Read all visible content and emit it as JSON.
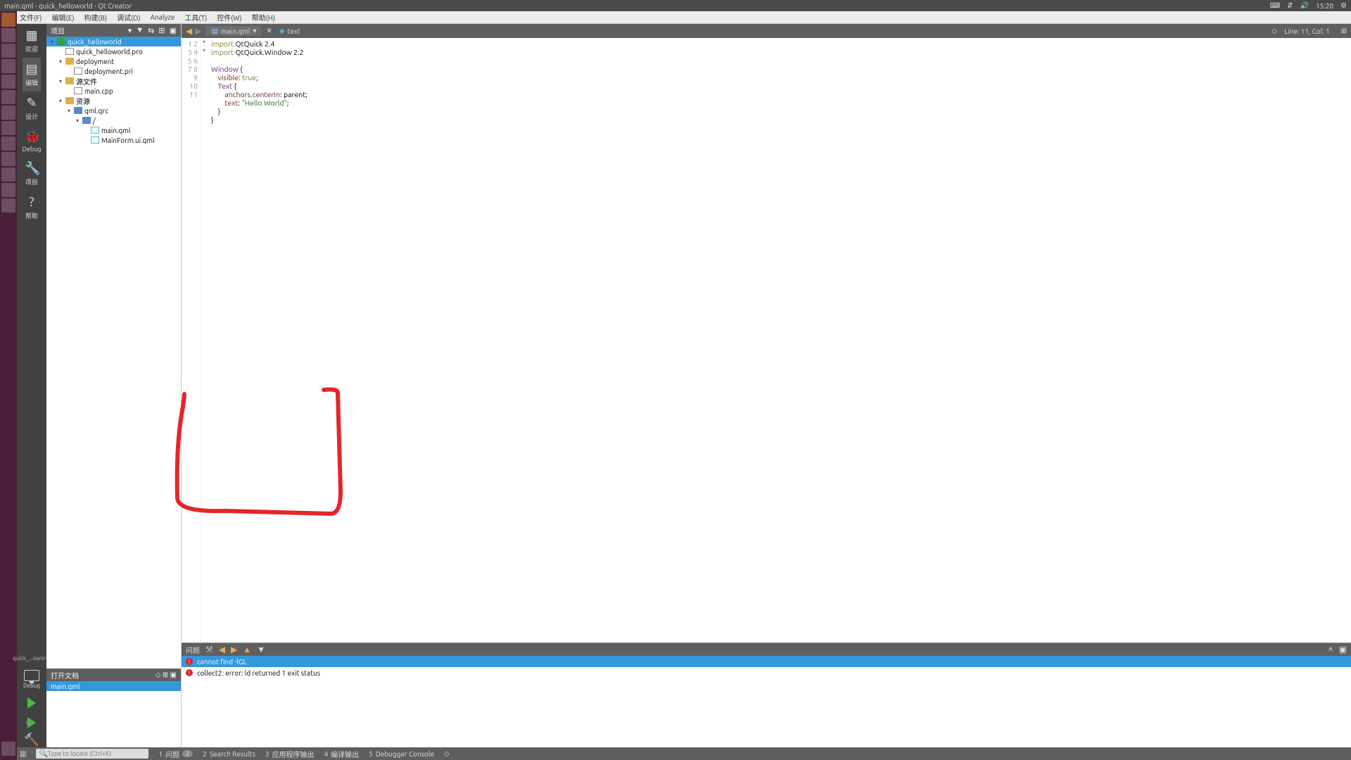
{
  "os": {
    "title": "main.qml - quick_helloworld - Qt Creator",
    "time": "15:20",
    "tray": [
      "keyboard-icon",
      "network-icon",
      "volume-icon",
      "settings-icon"
    ]
  },
  "menubar": [
    "文件(F)",
    "编辑(E)",
    "构建(B)",
    "调试(D)",
    "Analyze",
    "工具(T)",
    "控件(W)",
    "帮助(H)"
  ],
  "modes": [
    {
      "id": "welcome",
      "label": "欢迎",
      "icon": "grid-icon"
    },
    {
      "id": "edit",
      "label": "编辑",
      "icon": "edit-icon",
      "selected": true
    },
    {
      "id": "design",
      "label": "设计",
      "icon": "pencil-icon"
    },
    {
      "id": "debug",
      "label": "Debug",
      "icon": "bug-icon"
    },
    {
      "id": "projects",
      "label": "项目",
      "icon": "wrench-icon"
    },
    {
      "id": "help",
      "label": "帮助",
      "icon": "help-icon"
    }
  ],
  "kit": {
    "project": "quick_...oworld",
    "config": "Debug"
  },
  "project_header": {
    "title": "项目"
  },
  "tree": [
    {
      "depth": 0,
      "twist": "▾",
      "icon": "qt",
      "label": "quick_helloworld",
      "sel": true
    },
    {
      "depth": 1,
      "twist": "",
      "icon": "file",
      "label": "quick_helloworld.pro"
    },
    {
      "depth": 1,
      "twist": "▾",
      "icon": "folder",
      "label": "deployment"
    },
    {
      "depth": 2,
      "twist": "",
      "icon": "file",
      "label": "deployment.pri"
    },
    {
      "depth": 1,
      "twist": "▾",
      "icon": "folder",
      "label": "源文件"
    },
    {
      "depth": 2,
      "twist": "",
      "icon": "file",
      "label": "main.cpp"
    },
    {
      "depth": 1,
      "twist": "▾",
      "icon": "folder",
      "label": "资源"
    },
    {
      "depth": 2,
      "twist": "▾",
      "icon": "folder blue",
      "label": "qml.qrc"
    },
    {
      "depth": 3,
      "twist": "▾",
      "icon": "folder blue",
      "label": "/"
    },
    {
      "depth": 4,
      "twist": "",
      "icon": "qml",
      "label": "main.qml"
    },
    {
      "depth": 4,
      "twist": "",
      "icon": "qml",
      "label": "MainForm.ui.qml"
    }
  ],
  "open_docs": {
    "header": "打开文档",
    "items": [
      "main.qml"
    ]
  },
  "editor": {
    "filename": "main.qml",
    "symbol": "text",
    "position": "Line: 11, Col: 1",
    "lines": [
      {
        "n": 1,
        "fold": "",
        "html": "<span class='kw'>import</span> QtQuick 2.4"
      },
      {
        "n": 2,
        "fold": "",
        "html": "<span class='kw'>import</span> QtQuick.Window 2.2"
      },
      {
        "n": 3,
        "fold": "",
        "html": ""
      },
      {
        "n": 4,
        "fold": "▾",
        "html": "<span class='ty'>Window</span> {"
      },
      {
        "n": 5,
        "fold": "",
        "html": "    <span class='pr'>visible</span>: <span class='kw'>true</span>;"
      },
      {
        "n": 6,
        "fold": "▾",
        "html": "    <span class='ty'>Text</span> {"
      },
      {
        "n": 7,
        "fold": "",
        "html": "        <span class='pr'>anchors.centerIn</span>: parent;"
      },
      {
        "n": 8,
        "fold": "",
        "html": "        <span class='pr'>text</span>: <span class='st'>\"Hello World\"</span>;"
      },
      {
        "n": 9,
        "fold": "",
        "html": "    }"
      },
      {
        "n": 10,
        "fold": "",
        "html": "}"
      },
      {
        "n": 11,
        "fold": "",
        "html": ""
      }
    ]
  },
  "issues": {
    "header": "问题",
    "rows": [
      {
        "sel": true,
        "text": "cannot find -lGL"
      },
      {
        "sel": false,
        "text": "collect2: error: ld returned 1 exit status"
      }
    ]
  },
  "status": {
    "search_placeholder": "Type to locate (Ctrl+K)",
    "tabs": [
      {
        "n": "1",
        "label": "问题",
        "badge": "2"
      },
      {
        "n": "2",
        "label": "Search Results"
      },
      {
        "n": "3",
        "label": "应用程序输出"
      },
      {
        "n": "4",
        "label": "编译输出"
      },
      {
        "n": "5",
        "label": "Debugger Console"
      }
    ]
  }
}
